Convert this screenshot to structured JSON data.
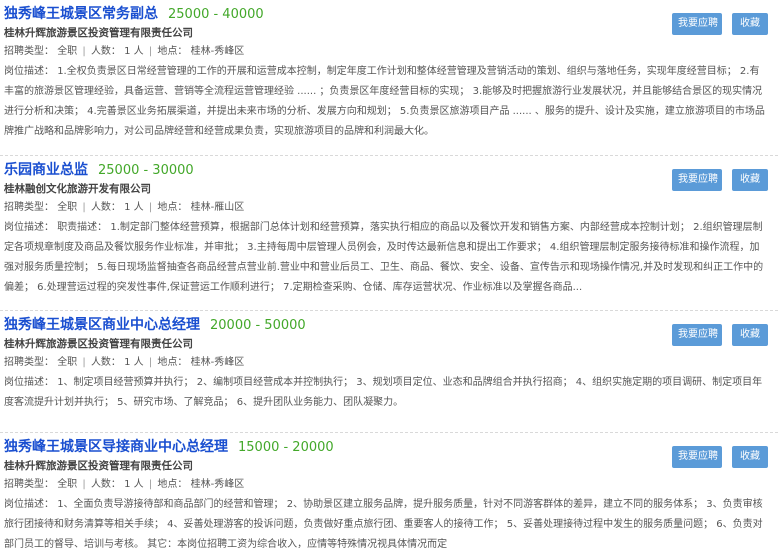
{
  "labels": {
    "job_type": "招聘类型：",
    "desc": "岗位描述：",
    "apply_button": "我要应聘",
    "favorite_button": "收藏",
    "meta_sep": "|"
  },
  "jobs": [
    {
      "title": "独秀峰王城景区常务副总",
      "salary": "25000 - 40000",
      "company": "桂林升辉旅游景区投资管理有限责任公司",
      "type": "全职",
      "headcount": "人数： 1 人",
      "location": "地点： 桂林-秀峰区",
      "description": "1.全权负责景区日常经营管理的工作的开展和运营成本控制，制定年度工作计划和整体经营管理及营销活动的策划、组织与落地任务，实现年度经营目标； 2.有丰富的旅游景区管理经验，具备运营、营销等全流程运营管理经验 ...... ；负责景区年度经营目标的实现； 3.能够及时把握旅游行业发展状况，并且能够结合景区的现实情况进行分析和决策； 4.完善景区业务拓展渠道，并提出未来市场的分析、发展方向和规划； 5.负责景区旅游项目产品 ...... 、服务的提升、设计及实施，建立旅游项目的市场品牌推广战略和品牌影响力，对公司品牌经营和经营成果负责，实现旅游项目的品牌和利润最大化。"
    },
    {
      "title": "乐园商业总监",
      "salary": "25000 - 30000",
      "company": "桂林融创文化旅游开发有限公司",
      "type": "全职",
      "headcount": "人数： 1 人",
      "location": "地点： 桂林-雁山区",
      "description": "职责描述： 1.制定部门整体经营预算，根据部门总体计划和经营预算，落实执行相应的商品以及餐饮开发和销售方案、内部经营成本控制计划； 2.组织管理层制定各项规章制度及商品及餐饮服务作业标准，并审批； 3.主持每周中层管理人员例会，及时传达最新信息和提出工作要求； 4.组织管理层制定服务接待标准和操作流程，加强对服务质量控制； 5.每日现场监督抽查各商品经营点营业前.营业中和营业后员工、卫生、商品、餐饮、安全、设备、宣传告示和现场操作情况,并及时发现和纠正工作中的偏差； 6.处理营运过程的突发性事件,保证营运工作顺利进行； 7.定期检查采购、仓储、库存运营状况、作业标准以及掌握各商品..."
    },
    {
      "title": "独秀峰王城景区商业中心总经理",
      "salary": "20000 - 50000",
      "company": "桂林升辉旅游景区投资管理有限责任公司",
      "type": "全职",
      "headcount": "人数： 1 人",
      "location": "地点： 桂林-秀峰区",
      "description": "1、制定项目经营预算并执行； 2、编制项目经营成本并控制执行； 3、规划项目定位、业态和品牌组合并执行招商； 4、组织实施定期的项目调研、制定项目年度客流提升计划并执行； 5、研究市场、了解竞品； 6、提升团队业务能力、团队凝聚力。"
    },
    {
      "title": "独秀峰王城景区导接商业中心总经理",
      "salary": "15000 - 20000",
      "company": "桂林升辉旅游景区投资管理有限责任公司",
      "type": "全职",
      "headcount": "人数： 1 人",
      "location": "地点： 桂林-秀峰区",
      "description": "1、全面负责导游接待部和商品部门的经营和管理； 2、协助景区建立服务品牌，提升服务质量，针对不同游客群体的差异，建立不同的服务体系； 3、负责审核旅行团接待和财务清算等相关手续； 4、妥善处理游客的投诉问题，负责做好重点旅行团、重要客人的接待工作； 5、妥善处理接待过程中发生的服务质量问题； 6、负责对部门员工的督导、培训与考核。 其它：本岗位招聘工资为综合收入，应情等特殊情况视具体情况而定"
    }
  ]
}
